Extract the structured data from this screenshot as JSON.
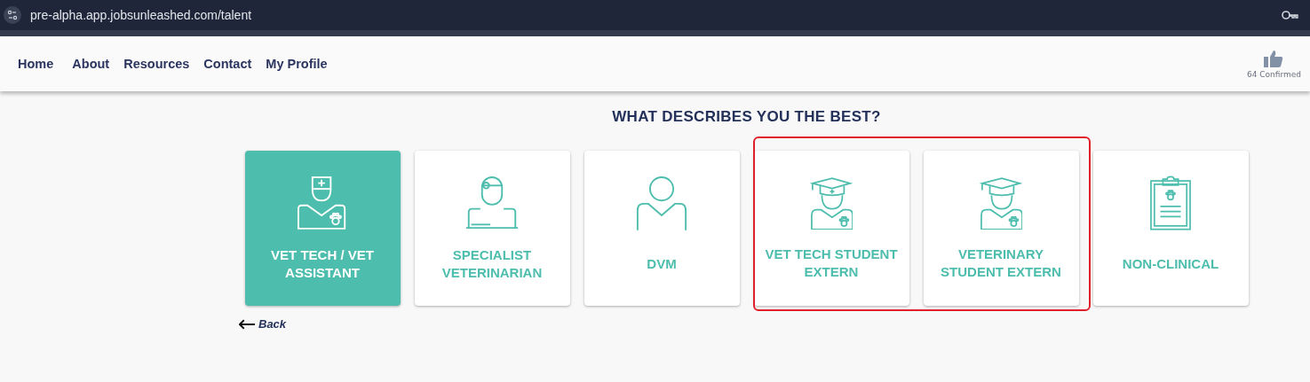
{
  "browser": {
    "url": "pre-alpha.app.jobsunleashed.com/talent"
  },
  "nav": {
    "links": [
      "Home",
      "About",
      "Resources",
      "Contact",
      "My Profile"
    ],
    "confirmed": "64 Confirmed"
  },
  "heading": "WHAT DESCRIBES YOU THE BEST?",
  "cards": [
    {
      "label": "VET TECH / VET ASSISTANT",
      "kind": "nurse",
      "selected": true,
      "highlighted": false
    },
    {
      "label": "SPECIALIST VETERINARIAN",
      "kind": "specialist",
      "selected": false,
      "highlighted": false
    },
    {
      "label": "DVM",
      "kind": "person",
      "selected": false,
      "highlighted": false
    },
    {
      "label": "VET TECH STUDENT EXTERN",
      "kind": "student-cross",
      "selected": false,
      "highlighted": true
    },
    {
      "label": "VETERINARY STUDENT EXTERN",
      "kind": "student",
      "selected": false,
      "highlighted": true
    },
    {
      "label": "NON-CLINICAL",
      "kind": "clipboard",
      "selected": false,
      "highlighted": false
    }
  ],
  "back": "Back"
}
